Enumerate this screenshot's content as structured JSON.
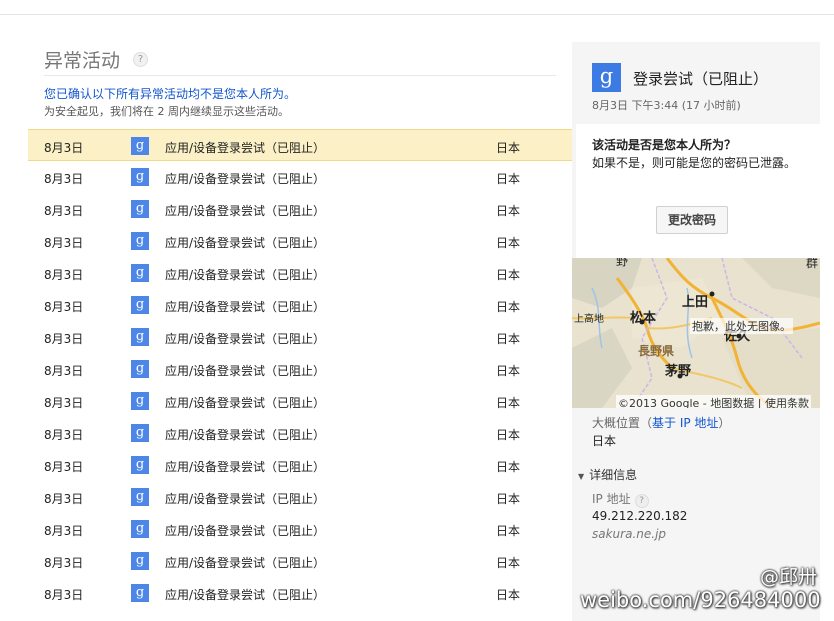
{
  "header": {
    "title": "异常活动",
    "help_icon": "?",
    "confirm_link": "您已确认以下所有异常活动均不是您本人所为。",
    "note": "为安全起见，我们将在 2 周内继续显示这些活动。"
  },
  "activity_rows": [
    {
      "date": "8月3日",
      "icon": "g",
      "description": "应用/设备登录尝试（已阻止）",
      "location": "日本"
    },
    {
      "date": "8月3日",
      "icon": "g",
      "description": "应用/设备登录尝试（已阻止）",
      "location": "日本"
    },
    {
      "date": "8月3日",
      "icon": "g",
      "description": "应用/设备登录尝试（已阻止）",
      "location": "日本"
    },
    {
      "date": "8月3日",
      "icon": "g",
      "description": "应用/设备登录尝试（已阻止）",
      "location": "日本"
    },
    {
      "date": "8月3日",
      "icon": "g",
      "description": "应用/设备登录尝试（已阻止）",
      "location": "日本"
    },
    {
      "date": "8月3日",
      "icon": "g",
      "description": "应用/设备登录尝试（已阻止）",
      "location": "日本"
    },
    {
      "date": "8月3日",
      "icon": "g",
      "description": "应用/设备登录尝试（已阻止）",
      "location": "日本"
    },
    {
      "date": "8月3日",
      "icon": "g",
      "description": "应用/设备登录尝试（已阻止）",
      "location": "日本"
    },
    {
      "date": "8月3日",
      "icon": "g",
      "description": "应用/设备登录尝试（已阻止）",
      "location": "日本"
    },
    {
      "date": "8月3日",
      "icon": "g",
      "description": "应用/设备登录尝试（已阻止）",
      "location": "日本"
    },
    {
      "date": "8月3日",
      "icon": "g",
      "description": "应用/设备登录尝试（已阻止）",
      "location": "日本"
    },
    {
      "date": "8月3日",
      "icon": "g",
      "description": "应用/设备登录尝试（已阻止）",
      "location": "日本"
    },
    {
      "date": "8月3日",
      "icon": "g",
      "description": "应用/设备登录尝试（已阻止）",
      "location": "日本"
    },
    {
      "date": "8月3日",
      "icon": "g",
      "description": "应用/设备登录尝试（已阻止）",
      "location": "日本"
    },
    {
      "date": "8月3日",
      "icon": "g",
      "description": "应用/设备登录尝试（已阻止）",
      "location": "日本"
    }
  ],
  "detail_panel": {
    "icon": "g",
    "title": "登录尝试（已阻止）",
    "time": "8月3日 下午3:44 (17 小时前)",
    "question": "该活动是否是您本人所为？",
    "answer": "如果不是，则可能是您的密码已泄露。",
    "change_password": "更改密码",
    "map": {
      "labels": [
        "上田",
        "松本",
        "佐久",
        "茅野",
        "長野県",
        "上高地",
        "群",
        "野"
      ],
      "no_image": "抱歉，此处无图像。",
      "copyright": "©2013 Google - 地图数据 | 使用条款"
    },
    "approx_location_label": "大概位置（",
    "approx_location_link": "基于 IP 地址",
    "approx_location_close": "）",
    "country": "日本",
    "details_toggle": "详细信息",
    "ip_label": "IP 地址",
    "ip_value": "49.212.220.182",
    "host": "sakura.ne.jp"
  },
  "watermark": {
    "line1": "@邱卅",
    "line2": "weibo.com/926484000"
  },
  "colors": {
    "selected_row": "#fbf0c6",
    "google_blue": "#4d86e8",
    "link": "#1155cc",
    "panel_bg": "#f5f5f5"
  }
}
